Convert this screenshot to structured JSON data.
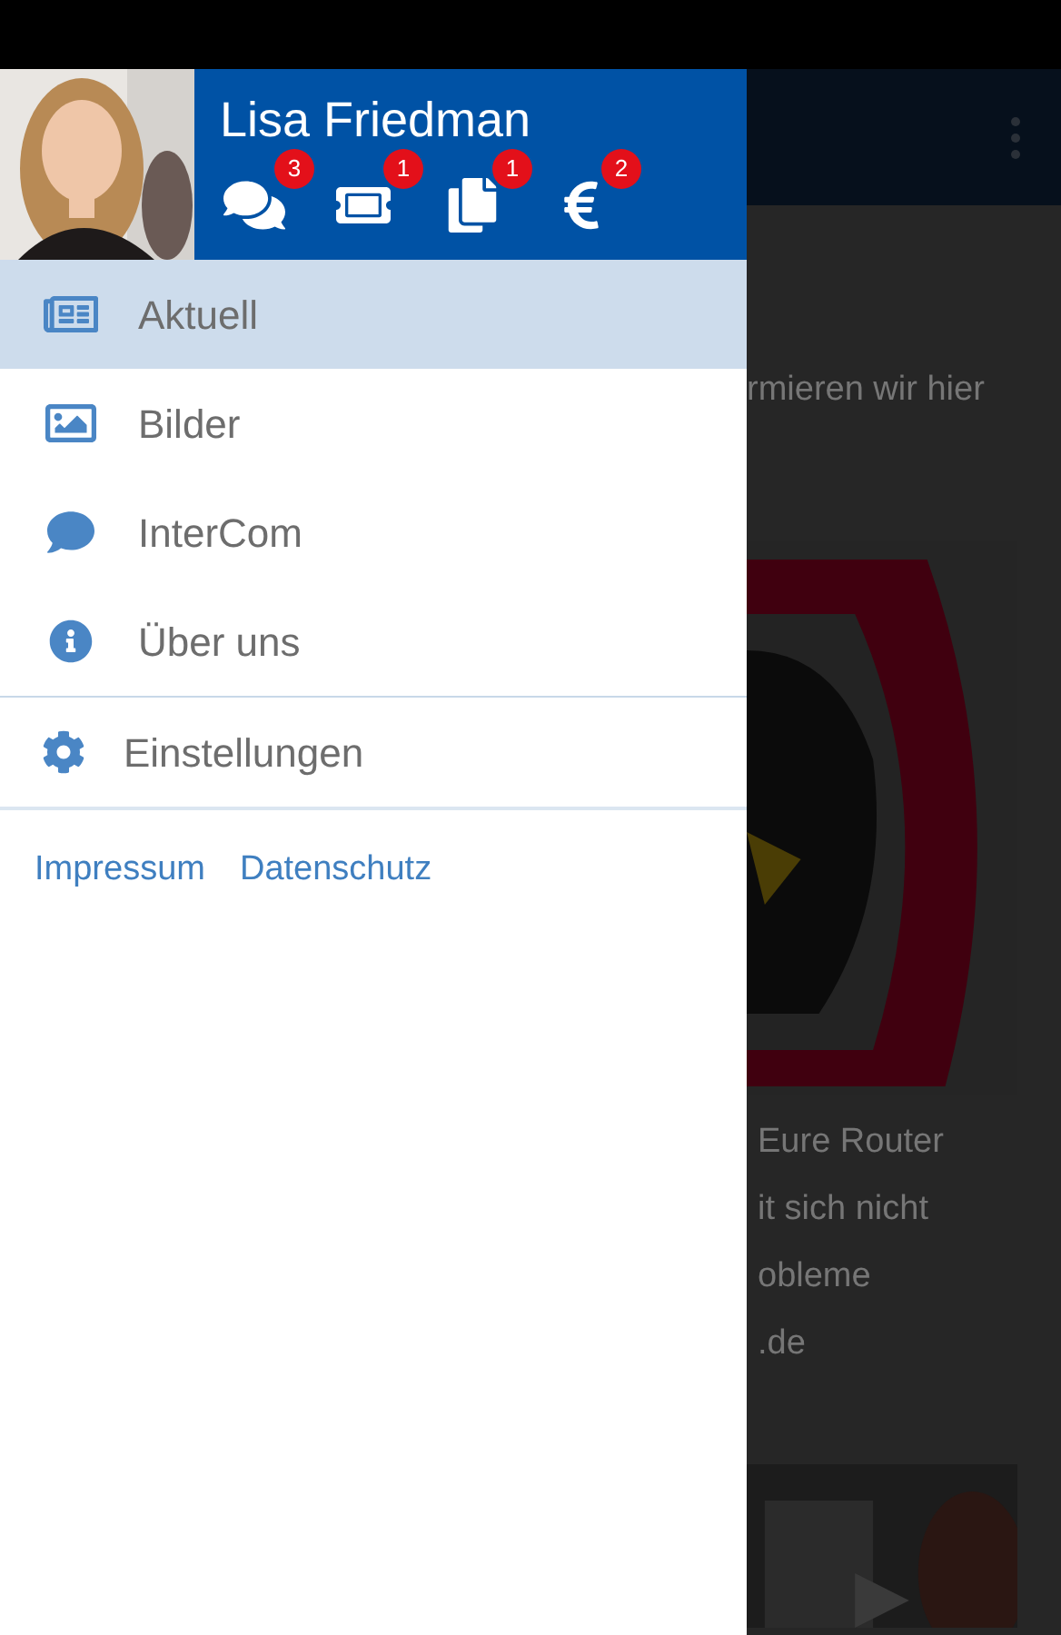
{
  "drawer": {
    "user": {
      "name": "Lisa Friedman"
    },
    "badges": [
      {
        "kind": "chats",
        "count": "3"
      },
      {
        "kind": "tickets",
        "count": "1"
      },
      {
        "kind": "documents",
        "count": "1"
      },
      {
        "kind": "payments",
        "count": "2"
      }
    ],
    "menu": [
      {
        "kind": "news",
        "label": "Aktuell",
        "selected": true
      },
      {
        "kind": "images",
        "label": "Bilder",
        "selected": false
      },
      {
        "kind": "chat",
        "label": "InterCom",
        "selected": false
      },
      {
        "kind": "info",
        "label": "Über uns",
        "selected": false
      }
    ],
    "settings": {
      "kind": "settings",
      "label": "Einstellungen",
      "selected": false
    },
    "links": [
      "Impressum",
      "Datenschutz"
    ]
  },
  "background": {
    "intro": "rmieren wir hier",
    "lines": [
      "Eure Router",
      "it sich nicht",
      "obleme",
      ".de"
    ]
  }
}
